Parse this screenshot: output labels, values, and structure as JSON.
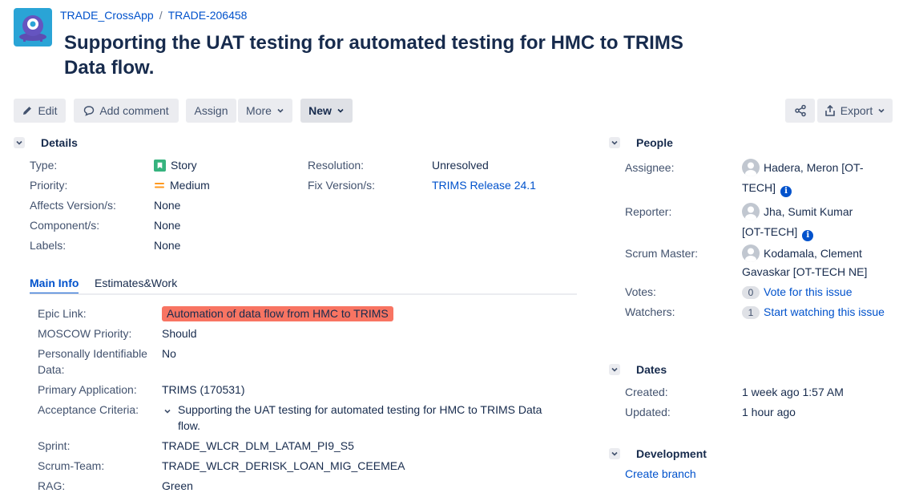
{
  "breadcrumb": {
    "project": "TRADE_CrossApp",
    "separator": "/",
    "issue_key": "TRADE-206458"
  },
  "issue": {
    "title": "Supporting the UAT testing for automated testing for HMC to TRIMS Data flow."
  },
  "toolbar": {
    "edit": "Edit",
    "add_comment": "Add comment",
    "assign": "Assign",
    "more": "More",
    "new": "New",
    "export": "Export"
  },
  "details": {
    "heading": "Details",
    "type_label": "Type:",
    "type_value": "Story",
    "priority_label": "Priority:",
    "priority_value": "Medium",
    "affects_label": "Affects Version/s:",
    "affects_value": "None",
    "component_label": "Component/s:",
    "component_value": "None",
    "labels_label": "Labels:",
    "labels_value": "None",
    "resolution_label": "Resolution:",
    "resolution_value": "Unresolved",
    "fix_label": "Fix Version/s:",
    "fix_value": "TRIMS Release 24.1"
  },
  "tabs": {
    "main_info": "Main Info",
    "estimates": "Estimates&Work"
  },
  "main_info": {
    "epic_label": "Epic Link:",
    "epic_value": "Automation of data flow from HMC to TRIMS",
    "moscow_label": "MOSCOW Priority:",
    "moscow_value": "Should",
    "pid_label_1": "Personally Identifiable",
    "pid_label_2": "Data:",
    "pid_value": "No",
    "primary_app_label": "Primary Application:",
    "primary_app_value": "TRIMS (170531)",
    "acceptance_label": "Acceptance Criteria:",
    "acceptance_line_1": "Supporting the UAT testing for automated testing for HMC to TRIMS Data",
    "acceptance_line_2": "flow.",
    "sprint_label": "Sprint:",
    "sprint_value": "TRADE_WLCR_DLM_LATAM_PI9_S5",
    "scrum_team_label": "Scrum-Team:",
    "scrum_team_value": "TRADE_WLCR_DERISK_LOAN_MIG_CEEMEA",
    "rag_label": "RAG:",
    "rag_value": "Green"
  },
  "people": {
    "heading": "People",
    "assignee_label": "Assignee:",
    "assignee_line_1": "Hadera, Meron [OT-",
    "assignee_line_2": "TECH]",
    "reporter_label": "Reporter:",
    "reporter_line_1": "Jha, Sumit Kumar",
    "reporter_line_2": "[OT-TECH]",
    "scrum_master_label": "Scrum Master:",
    "scrum_master_line_1": "Kodamala, Clement",
    "scrum_master_line_2": "Gavaskar [OT-TECH NE]",
    "votes_label": "Votes:",
    "votes_count": "0",
    "votes_link": "Vote for this issue",
    "watchers_label": "Watchers:",
    "watchers_count": "1",
    "watchers_link": "Start watching this issue"
  },
  "dates": {
    "heading": "Dates",
    "created_label": "Created:",
    "created_value": "1 week ago 1:57 AM",
    "updated_label": "Updated:",
    "updated_value": "1 hour ago"
  },
  "development": {
    "heading": "Development",
    "create_branch": "Create branch"
  },
  "icons": {
    "project": "project-avatar-icon",
    "story": "story-icon",
    "priority": "priority-medium-icon",
    "edit": "pencil-icon",
    "comment": "comment-icon",
    "share": "share-icon",
    "export": "export-icon",
    "info": "info-icon",
    "avatar": "user-avatar-icon"
  },
  "colors": {
    "link": "#0052cc",
    "epic": "#f87462",
    "story": "#36b37e",
    "priority": "#ff991f",
    "project": "#2aa4d6"
  }
}
